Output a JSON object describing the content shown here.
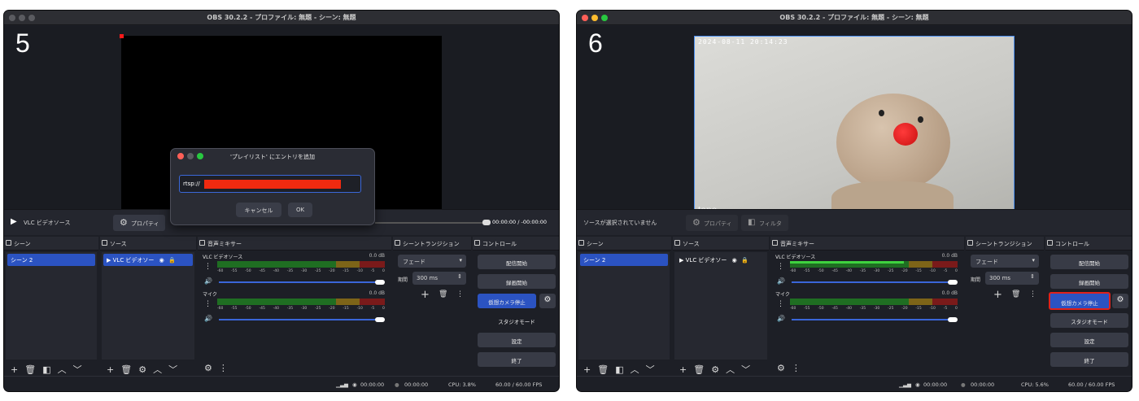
{
  "panels": [
    {
      "step": "5",
      "title": "OBS 30.2.2 - プロファイル: 無題 - シーン: 無題",
      "source_bar": {
        "source_name": "VLC ビデオソース",
        "properties_label": "プロパティ",
        "time": "00:00:00 / -00:00:00"
      },
      "dialog": {
        "title": "'プレイリスト' にエントリを追加",
        "input_value": "rtsp://",
        "cancel_label": "キャンセル",
        "ok_label": "OK"
      },
      "docks": {
        "scenes": "シーン",
        "sources": "ソース",
        "mixer": "音声ミキサー",
        "transitions": "シーントランジション",
        "controls": "コントロール"
      },
      "scene_item": "シーン 2",
      "source_item": "VLC ビデオソー",
      "mixer": {
        "channels": [
          {
            "name": "VLC ビデオソース",
            "level": "0.0 dB"
          },
          {
            "name": "マイク",
            "level": "0.0 dB"
          }
        ],
        "ticks": [
          "-60",
          "-55",
          "-50",
          "-45",
          "-40",
          "-35",
          "-30",
          "-25",
          "-20",
          "-15",
          "-10",
          "-5",
          "0"
        ]
      },
      "transition": {
        "type": "フェード",
        "duration_label": "期間",
        "duration": "300 ms"
      },
      "controls": [
        "配信開始",
        "録画開始",
        "仮想カメラ停止",
        "スタジオモード",
        "設定",
        "終了"
      ],
      "status": {
        "rec_time": "00:00:00",
        "stream_time": "00:00:00",
        "cpu": "CPU: 3.8%",
        "fps": "60.00 / 60.00 FPS"
      }
    },
    {
      "step": "6",
      "title": "OBS 30.2.2 - プロファイル: 無題 - シーン: 無題",
      "timestamp": "2024-08-11 20:14:23",
      "camera_brand": "tapo",
      "source_bar": {
        "no_source": "ソースが選択されていません",
        "properties_label": "プロパティ",
        "filters_label": "フィルタ"
      },
      "docks": {
        "scenes": "シーン",
        "sources": "ソース",
        "mixer": "音声ミキサー",
        "transitions": "シーントランジション",
        "controls": "コントロール"
      },
      "scene_item": "シーン 2",
      "source_item": "VLC ビデオソー",
      "mixer": {
        "channels": [
          {
            "name": "VLC ビデオソース",
            "level": "0.0 dB"
          },
          {
            "name": "マイク",
            "level": "0.0 dB"
          }
        ],
        "ticks": [
          "-60",
          "-55",
          "-50",
          "-45",
          "-40",
          "-35",
          "-30",
          "-25",
          "-20",
          "-15",
          "-10",
          "-5",
          "0"
        ]
      },
      "transition": {
        "type": "フェード",
        "duration_label": "期間",
        "duration": "300 ms"
      },
      "controls": [
        "配信開始",
        "録画開始",
        "仮想カメラ停止",
        "スタジオモード",
        "設定",
        "終了"
      ],
      "status": {
        "rec_time": "00:00:00",
        "stream_time": "00:00:00",
        "cpu": "CPU: 5.6%",
        "fps": "60.00 / 60.00 FPS"
      }
    }
  ],
  "colors": {
    "accent": "#2b53c2",
    "highlight": "#e0221b",
    "redaction": "#f02a10"
  }
}
